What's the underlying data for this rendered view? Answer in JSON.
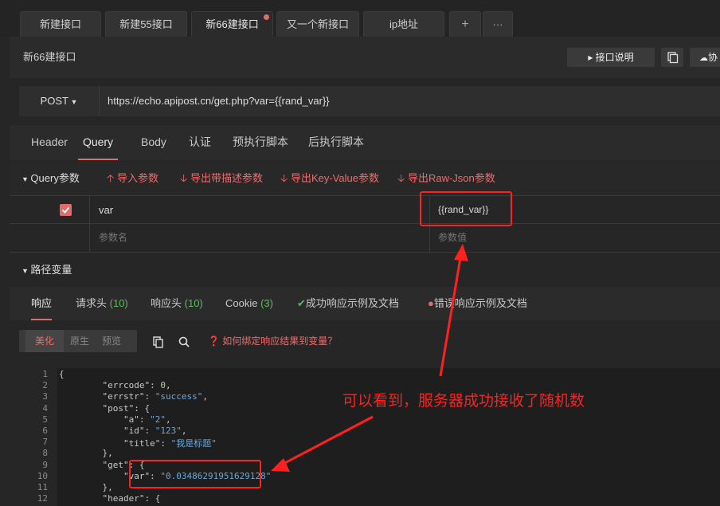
{
  "tabs": [
    {
      "label": "新建接口"
    },
    {
      "label": "新建55接口"
    },
    {
      "label": "新66建接口"
    },
    {
      "label": "又一个新接口"
    },
    {
      "label": "ip地址"
    },
    {
      "label": "+"
    },
    {
      "label": "···"
    }
  ],
  "page_title": "新66建接口",
  "toolbar": {
    "doc_label": "▸ 接口说明",
    "copy_icon": "copy-icon",
    "collab_label": "协"
  },
  "request": {
    "method": "POST",
    "url": "https://echo.apipost.cn/get.php?var={{rand_var}}"
  },
  "subtabs": [
    "Header",
    "Query",
    "Body",
    "认证",
    "预执行脚本",
    "后执行脚本"
  ],
  "query": {
    "section_label": "Query参数",
    "actions": [
      "导入参数",
      "导出带描述参数",
      "导出Key-Value参数",
      "导出Raw-Json参数"
    ],
    "row": {
      "key": "var",
      "value": "{{rand_var}}"
    },
    "placeholder": {
      "key": "参数名",
      "value": "参数值"
    }
  },
  "path_vars": {
    "label": "路径变量"
  },
  "response_tabs": {
    "resp": "响应",
    "req_headers": "请求头",
    "req_headers_count": "(10)",
    "resp_headers": "响应头",
    "resp_headers_count": "(10)",
    "cookie": "Cookie",
    "cookie_count": "(3)",
    "success_doc": "成功响应示例及文档",
    "error_doc": "错误响应示例及文档"
  },
  "view": {
    "pretty": "美化",
    "raw": "原生",
    "preview": "预览",
    "bind_hint": "如何绑定响应结果到变量？"
  },
  "code_lines": [
    {
      "n": "1",
      "t": "{"
    },
    {
      "n": "2",
      "t": "    \"errcode\": 0,"
    },
    {
      "n": "3",
      "t": "    \"errstr\": \"success\","
    },
    {
      "n": "4",
      "t": "    \"post\": {"
    },
    {
      "n": "5",
      "t": "        \"a\": \"2\","
    },
    {
      "n": "6",
      "t": "        \"id\": \"123\","
    },
    {
      "n": "7",
      "t": "        \"title\": \"我是标题\""
    },
    {
      "n": "8",
      "t": "    },"
    },
    {
      "n": "9",
      "t": "    \"get\": {"
    },
    {
      "n": "10",
      "t": "        \"var\": \"0.03486291951629128\""
    },
    {
      "n": "11",
      "t": "    },"
    },
    {
      "n": "12",
      "t": "    \"header\": {"
    }
  ],
  "annotation": "可以看到，服务器成功接收了随机数",
  "colors": {
    "accent": "#e06c6c",
    "annotation": "#ff2020",
    "count": "#5fb95f",
    "string": "#6aa8d8"
  }
}
